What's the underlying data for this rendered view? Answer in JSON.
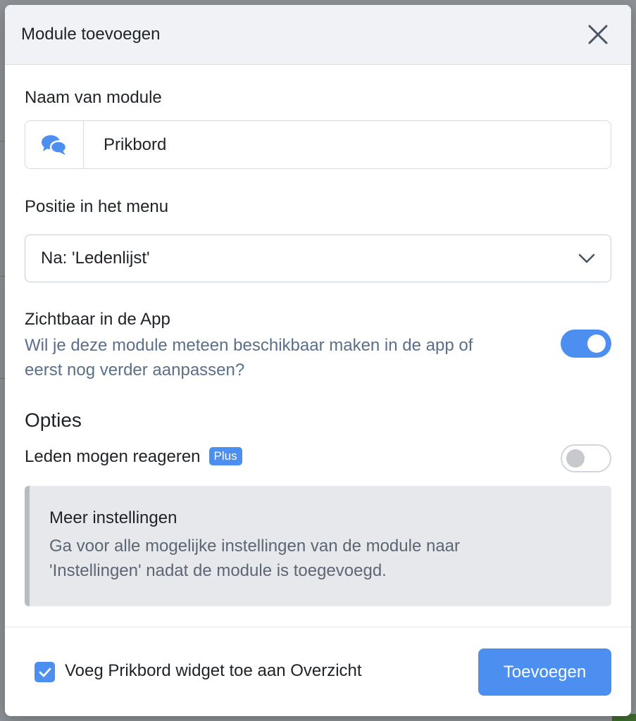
{
  "modal": {
    "title": "Module toevoegen"
  },
  "name_field": {
    "label": "Naam van module",
    "value": "Prikbord",
    "icon": "comments-icon"
  },
  "position_field": {
    "label": "Positie in het menu",
    "selected": "Na: 'Ledenlijst'"
  },
  "visibility": {
    "title": "Zichtbaar in de App",
    "description_line1": "Wil je deze module meteen beschikbaar maken in de app of",
    "description_line2": "eerst nog verder aanpassen?",
    "enabled": true
  },
  "options": {
    "title": "Opties",
    "members_react_label": "Leden mogen reageren",
    "members_react_badge": "Plus",
    "members_react_enabled": false
  },
  "info": {
    "title": "Meer instellingen",
    "text_line1": "Ga voor alle mogelijke instellingen van de module naar",
    "text_line2": "'Instellingen' nadat de module is toegevoegd."
  },
  "footer": {
    "checkbox_label": "Voeg Prikbord widget toe aan Overzicht",
    "checkbox_checked": true,
    "submit_label": "Toevoegen"
  },
  "colors": {
    "accent": "#4c8ff0",
    "header_bg": "#f0f2f6",
    "muted_text": "#5a6f8a"
  }
}
